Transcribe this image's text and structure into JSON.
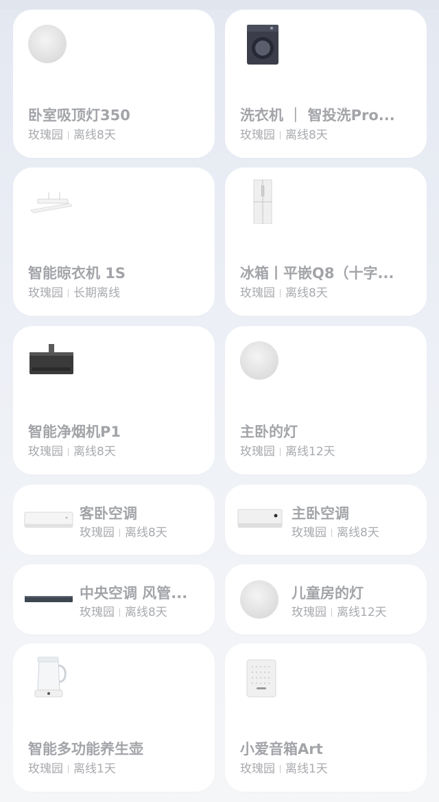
{
  "devices": [
    {
      "name": "卧室吸顶灯350",
      "room": "玫瑰园",
      "status": "离线8天",
      "icon": "ceiling-light-icon"
    },
    {
      "name": "洗衣机 ｜ 智投洗Pro...",
      "room": "玫瑰园",
      "status": "离线8天",
      "icon": "washing-machine-icon"
    },
    {
      "name": "智能晾衣机 1S",
      "room": "玫瑰园",
      "status": "长期离线",
      "icon": "clothes-dryer-rack-icon"
    },
    {
      "name": "冰箱丨平嵌Q8（十字...",
      "room": "玫瑰园",
      "status": "离线8天",
      "icon": "refrigerator-icon"
    },
    {
      "name": "智能净烟机P1",
      "room": "玫瑰园",
      "status": "离线8天",
      "icon": "range-hood-icon"
    },
    {
      "name": "主卧的灯",
      "room": "玫瑰园",
      "status": "离线12天",
      "icon": "ceiling-light-icon"
    },
    {
      "name": "客卧空调",
      "room": "玫瑰园",
      "status": "离线8天",
      "icon": "air-conditioner-icon"
    },
    {
      "name": "主卧空调",
      "room": "玫瑰园",
      "status": "离线8天",
      "icon": "air-conditioner-icon"
    },
    {
      "name": "中央空调 风管...",
      "room": "玫瑰园",
      "status": "离线8天",
      "icon": "duct-ac-icon"
    },
    {
      "name": "儿童房的灯",
      "room": "玫瑰园",
      "status": "离线12天",
      "icon": "ceiling-light-icon"
    },
    {
      "name": "智能多功能养生壶",
      "room": "玫瑰园",
      "status": "离线1天",
      "icon": "health-kettle-icon"
    },
    {
      "name": "小爱音箱Art",
      "room": "玫瑰园",
      "status": "离线1天",
      "icon": "smart-speaker-icon"
    }
  ]
}
